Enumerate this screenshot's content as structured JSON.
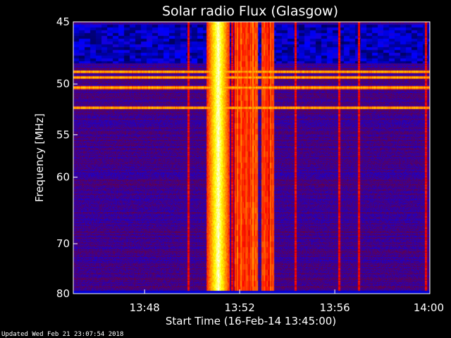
{
  "chart_data": {
    "type": "heatmap",
    "title": "Solar radio Flux (Glasgow)",
    "xlabel": "Start Time (16-Feb-14 13:45:00)",
    "ylabel": "Frequency [MHz]",
    "x_range": [
      "13:45:00",
      "14:00:00"
    ],
    "y_range_mhz": [
      45,
      80
    ],
    "y_scale": "reciprocal (frequency increases downward, ticks compress toward bottom)",
    "x_ticks": [
      "13:48",
      "13:52",
      "13:56",
      "14:00"
    ],
    "y_ticks": [
      "45",
      "50",
      "55",
      "60",
      "70",
      "80"
    ],
    "colormap": [
      "#000010",
      "#0000ff",
      "#8b0000",
      "#ff0000",
      "#ff8c00",
      "#ffff00",
      "#ffffff"
    ],
    "features": {
      "band_45_48_mhz": "dark navy with scattered bright blue patches",
      "interference_lines_mhz": [
        48.9,
        49.4,
        50.3,
        52.2
      ],
      "strong_burst_time_range": [
        "13:50:50",
        "13:51:20"
      ],
      "secondary_burst_time_ranges": [
        [
          "13:51:50",
          "13:52:40"
        ],
        [
          "13:53:00",
          "13:53:20"
        ]
      ],
      "vertical_streaks_times": [
        "13:49:50",
        "13:51:40",
        "13:54:20",
        "13:56:10",
        "13:57:00",
        "13:59:50"
      ]
    }
  },
  "footer": {
    "updated_text": "Updated Wed Feb 21 23:07:54 2018"
  }
}
